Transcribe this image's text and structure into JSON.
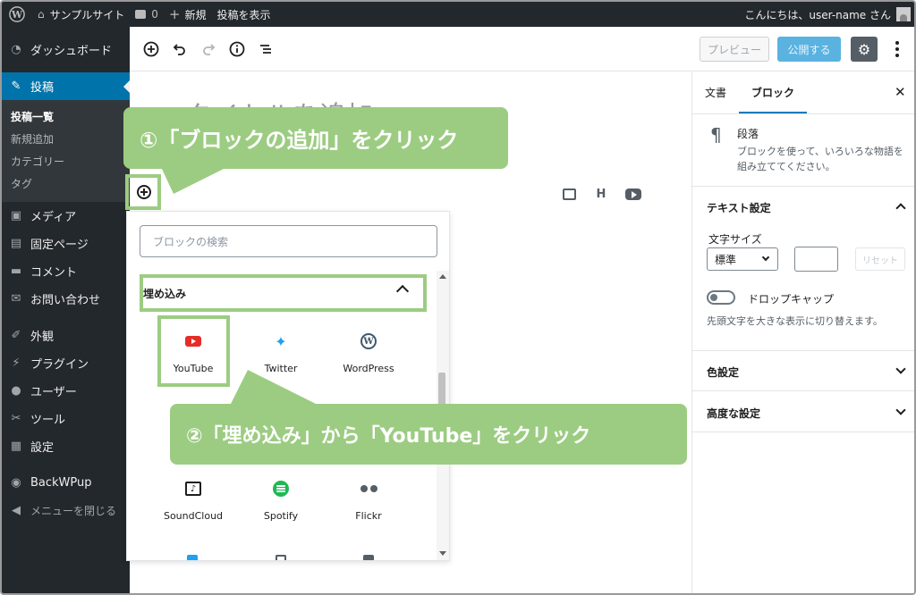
{
  "admin_bar": {
    "site_name": "サンプルサイト",
    "comment_count": "0",
    "new_label": "新規",
    "view_post": "投稿を表示",
    "greeting": "こんにちは、user-name さん"
  },
  "sidebar": {
    "items": [
      {
        "label": "ダッシュボード",
        "icon": "dashboard-icon"
      },
      {
        "label": "投稿",
        "icon": "pin-icon"
      },
      {
        "label": "メディア",
        "icon": "media-icon"
      },
      {
        "label": "固定ページ",
        "icon": "page-icon"
      },
      {
        "label": "コメント",
        "icon": "comment-icon"
      },
      {
        "label": "お問い合わせ",
        "icon": "mail-icon"
      },
      {
        "label": "外観",
        "icon": "brush-icon"
      },
      {
        "label": "プラグイン",
        "icon": "plugin-icon"
      },
      {
        "label": "ユーザー",
        "icon": "user-icon"
      },
      {
        "label": "ツール",
        "icon": "wrench-icon"
      },
      {
        "label": "設定",
        "icon": "settings-icon"
      },
      {
        "label": "BackWPup",
        "icon": "backwpup-icon"
      },
      {
        "label": "メニューを閉じる",
        "icon": "collapse-icon"
      }
    ],
    "submenu": [
      "投稿一覧",
      "新規追加",
      "カテゴリー",
      "タグ"
    ]
  },
  "toolbar": {
    "preview_label": "プレビュー",
    "publish_label": "公開する"
  },
  "editor": {
    "title_placeholder": "タイトルを追加"
  },
  "inserter": {
    "search_placeholder": "ブロックの検索",
    "category": "埋め込み",
    "blocks": [
      {
        "label": "YouTube",
        "icon": "youtube-icon"
      },
      {
        "label": "Twitter",
        "icon": "twitter-icon"
      },
      {
        "label": "WordPress",
        "icon": "wordpress-icon"
      },
      {
        "label": "SoundCloud",
        "icon": "soundcloud-icon"
      },
      {
        "label": "Spotify",
        "icon": "spotify-icon"
      },
      {
        "label": "Flickr",
        "icon": "flickr-icon"
      }
    ]
  },
  "callouts": {
    "step1": "①「ブロックの追加」をクリック",
    "step2": "②「埋め込み」から「YouTube」をクリック"
  },
  "settings_sidebar": {
    "tabs": [
      "文書",
      "ブロック"
    ],
    "block_name": "段落",
    "block_desc": "ブロックを使って、いろいろな物語を組み立ててください。",
    "text_settings": "テキスト設定",
    "font_size_label": "文字サイズ",
    "font_size_value": "標準",
    "reset_label": "リセット",
    "drop_cap_label": "ドロップキャップ",
    "drop_cap_help": "先頭文字を大きな表示に切り替えます。",
    "color_settings": "色設定",
    "advanced_settings": "高度な設定"
  },
  "colors": {
    "admin_dark": "#23282d",
    "accent_blue": "#0073aa",
    "callout_green": "#9ccc82"
  }
}
